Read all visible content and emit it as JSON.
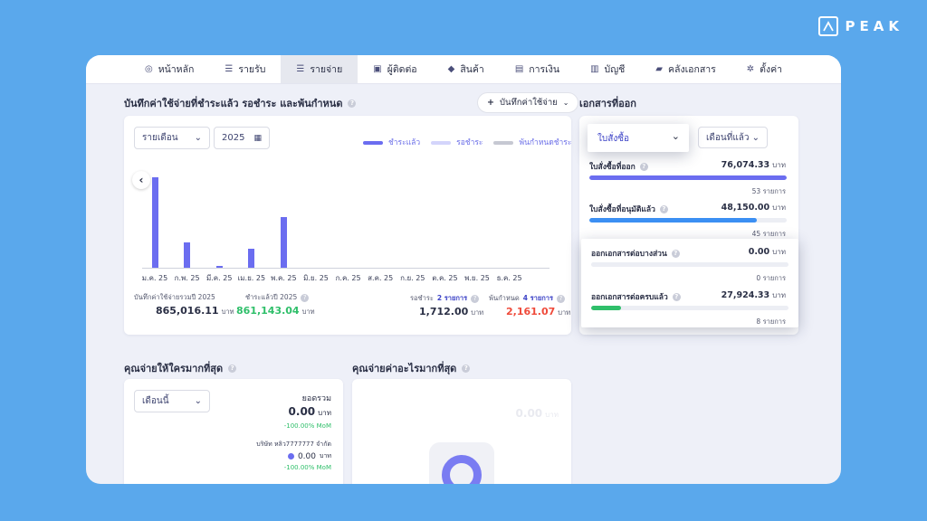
{
  "brand": {
    "logo_text": "PEAK"
  },
  "nav": [
    {
      "label": "หน้าหลัก",
      "icon": "home-icon",
      "glyph": "◎"
    },
    {
      "label": "รายรับ",
      "icon": "income-list-icon",
      "glyph": "☰"
    },
    {
      "label": "รายจ่าย",
      "icon": "expense-list-icon",
      "glyph": "☰",
      "active": true
    },
    {
      "label": "ผู้ติดต่อ",
      "icon": "contacts-icon",
      "glyph": "▣"
    },
    {
      "label": "สินค้า",
      "icon": "product-box-icon",
      "glyph": "◆"
    },
    {
      "label": "การเงิน",
      "icon": "money-icon",
      "glyph": "▤"
    },
    {
      "label": "บัญชี",
      "icon": "ledger-icon",
      "glyph": "▥"
    },
    {
      "label": "คลังเอกสาร",
      "icon": "folder-icon",
      "glyph": "▰"
    },
    {
      "label": "ตั้งค่า",
      "icon": "gear-icon",
      "glyph": "✲"
    }
  ],
  "expense_section": {
    "title": "บันทึกค่าใช้จ่ายที่ชำระแล้ว รอชำระ และพ้นกำหนด",
    "add_button": "บันทึกค่าใช้จ่าย",
    "period_select": "รายเดือน",
    "year_select": "2025",
    "legend": [
      {
        "label": "ชำระแล้ว",
        "color": "#6b6df0"
      },
      {
        "label": "รอชำระ",
        "color": "#d3d4fb"
      },
      {
        "label": "พ้นกำหนดชำระ",
        "color": "#c6c8d2"
      }
    ],
    "stats": {
      "total_label": "บันทึกค่าใช้จ่ายรวมปี 2025",
      "total_value": "865,016.11",
      "paid_label": "ชำระแล้วปี 2025",
      "paid_value": "861,143.04",
      "pending_label": "รอชำระ",
      "pending_count": "2 รายการ",
      "pending_value": "1,712.00",
      "overdue_label": "พ้นกำหนด",
      "overdue_count": "4 รายการ",
      "overdue_value": "2,161.07",
      "unit": "บาท"
    }
  },
  "chart_data": {
    "type": "bar",
    "categories": [
      "ม.ค. 25",
      "ก.พ. 25",
      "มี.ค. 25",
      "เม.ย. 25",
      "พ.ค. 25",
      "มิ.ย. 25",
      "ก.ค. 25",
      "ส.ค. 25",
      "ก.ย. 25",
      "ต.ค. 25",
      "พ.ย. 25",
      "ธ.ค. 25"
    ],
    "series": [
      {
        "name": "ชำระแล้ว",
        "values": [
          100,
          28,
          2,
          21,
          56,
          0,
          0,
          0,
          0,
          0,
          0,
          0
        ]
      }
    ],
    "ylim": [
      0,
      110
    ]
  },
  "documents_section": {
    "title": "เอกสารที่ออก",
    "doc_type_select": "ใบสั่งซื้อ",
    "period_select": "เดือนที่แล้ว",
    "rows": [
      {
        "label": "ใบสั่งซื้อที่ออก",
        "value": "76,074.33",
        "unit": "บาท",
        "count": "53 รายการ",
        "fill": 1.0,
        "color": "#6b6df0"
      },
      {
        "label": "ใบสั่งซื้อที่อนุมัติแล้ว",
        "value": "48,150.00",
        "unit": "บาท",
        "count": "45 รายการ",
        "fill": 0.85,
        "color": "#3b8ff3"
      },
      {
        "label": "ออกเอกสารต่อบางส่วน",
        "value": "0.00",
        "unit": "บาท",
        "count": "0 รายการ",
        "fill": 0.0,
        "color": "#3b8ff3"
      },
      {
        "label": "ออกเอกสารต่อครบแล้ว",
        "value": "27,924.33",
        "unit": "บาท",
        "count": "8 รายการ",
        "fill": 0.15,
        "color": "#2fbf6a"
      }
    ]
  },
  "who_section": {
    "title": "คุณจ่ายให้ใครมากที่สุด",
    "period_select": "เดือนนี้",
    "total_label": "ยอดรวม",
    "total_value": "0.00",
    "unit": "บาท",
    "mom": "-100.00% MoM",
    "vendor_name": "บริษัท หลิว7777777 จำกัด",
    "vendor_value": "0.00",
    "vendor_mom": "-100.00% MoM"
  },
  "what_section": {
    "title": "คุณจ่ายค่าอะไรมากที่สุด",
    "total_value": "0.00",
    "unit": "บาท"
  }
}
